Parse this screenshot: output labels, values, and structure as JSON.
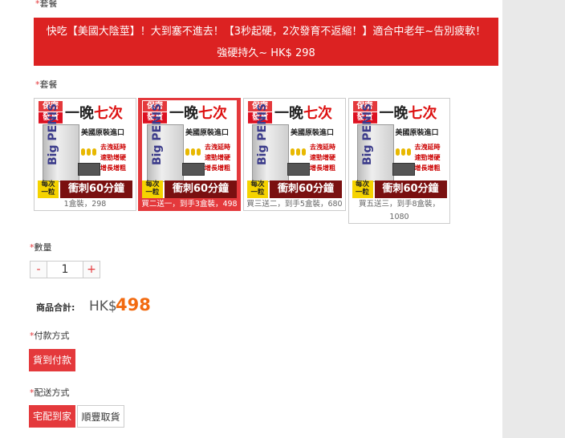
{
  "header": {
    "required_mark": "*",
    "label": "套餐"
  },
  "banner": {
    "line1": "快吃【美國大陰莖】！大到塞不進去！【3秒起硬，2次發育不返縮！】適合中老年~告別疲軟！",
    "line2": "強硬持久~ HK$ 298"
  },
  "package_section": {
    "required_mark": "*",
    "label": "套餐"
  },
  "product_image": {
    "tag_top": "保密",
    "tag_bottom": "發貨",
    "headline_a": "一晚",
    "headline_b": "七次",
    "subline": "美國原裝進口",
    "brand": "Big PENIS",
    "effect_1": "去洩延時",
    "effect_2": "速勁增硬",
    "effect_3": "增長增粗",
    "once_a": "每次",
    "once_b": "一粒",
    "impact": "衝刺60分鐘"
  },
  "packages": [
    {
      "caption": "1盒裝，298",
      "selected": false
    },
    {
      "caption": "買二送一，到手3盒裝，498",
      "selected": true
    },
    {
      "caption": "買三送二，到手5盒裝，680",
      "selected": false
    },
    {
      "caption": "買五送三，到手8盒裝，1080",
      "selected": false
    }
  ],
  "quantity": {
    "required_mark": "*",
    "label": "數量",
    "minus": "-",
    "value": "1",
    "plus": "+"
  },
  "total": {
    "label": "商品合計:",
    "currency": "HK$",
    "amount": "498"
  },
  "payment": {
    "required_mark": "*",
    "label": "付款方式",
    "options": [
      "貨到付款"
    ]
  },
  "delivery": {
    "required_mark": "*",
    "label": "配送方式",
    "options": [
      "宅配到家",
      "順豐取貨"
    ]
  },
  "colors": {
    "accent": "#e4393c",
    "banner": "#dc2222",
    "price": "#f26a10"
  }
}
